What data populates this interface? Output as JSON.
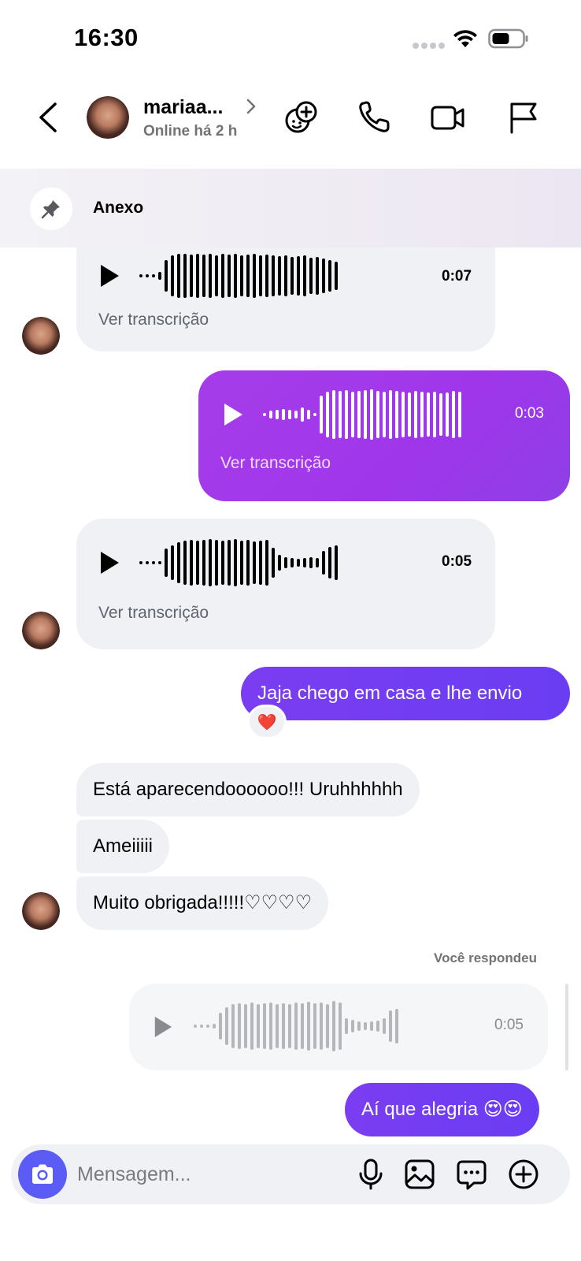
{
  "status_bar": {
    "time": "16:30"
  },
  "header": {
    "contact_name": "mariaa...",
    "contact_status": "Online há 2 h"
  },
  "pinned": {
    "label": "Anexo"
  },
  "messages": [
    {
      "type": "voice",
      "direction": "incoming",
      "duration": "0:07",
      "transcript_label": "Ver transcrição"
    },
    {
      "type": "voice",
      "direction": "outgoing",
      "duration": "0:03",
      "transcript_label": "Ver transcrição"
    },
    {
      "type": "voice",
      "direction": "incoming",
      "duration": "0:05",
      "transcript_label": "Ver transcrição"
    },
    {
      "type": "text",
      "direction": "outgoing",
      "text": "Jaja chego em casa e lhe envio",
      "reaction": "❤️"
    },
    {
      "type": "text",
      "direction": "incoming",
      "text": "Está aparecendoooooo!!! Uruhhhhhh"
    },
    {
      "type": "text",
      "direction": "incoming",
      "text": "Ameiiiii"
    },
    {
      "type": "text",
      "direction": "incoming",
      "text": "Muito obrigada!!!!!♡♡♡♡"
    },
    {
      "type": "reply_context",
      "label": "Você respondeu",
      "quoted_duration": "0:05"
    },
    {
      "type": "text",
      "direction": "outgoing",
      "text": "Aí que alegria 😍😍"
    }
  ],
  "composer": {
    "placeholder": "Mensagem..."
  },
  "colors": {
    "outgoing_bubble": "#6a3df2",
    "outgoing_voice_bubble": "#9f36ea",
    "incoming_bubble": "#f0f1f4",
    "camera_button": "#5b5cf6"
  }
}
